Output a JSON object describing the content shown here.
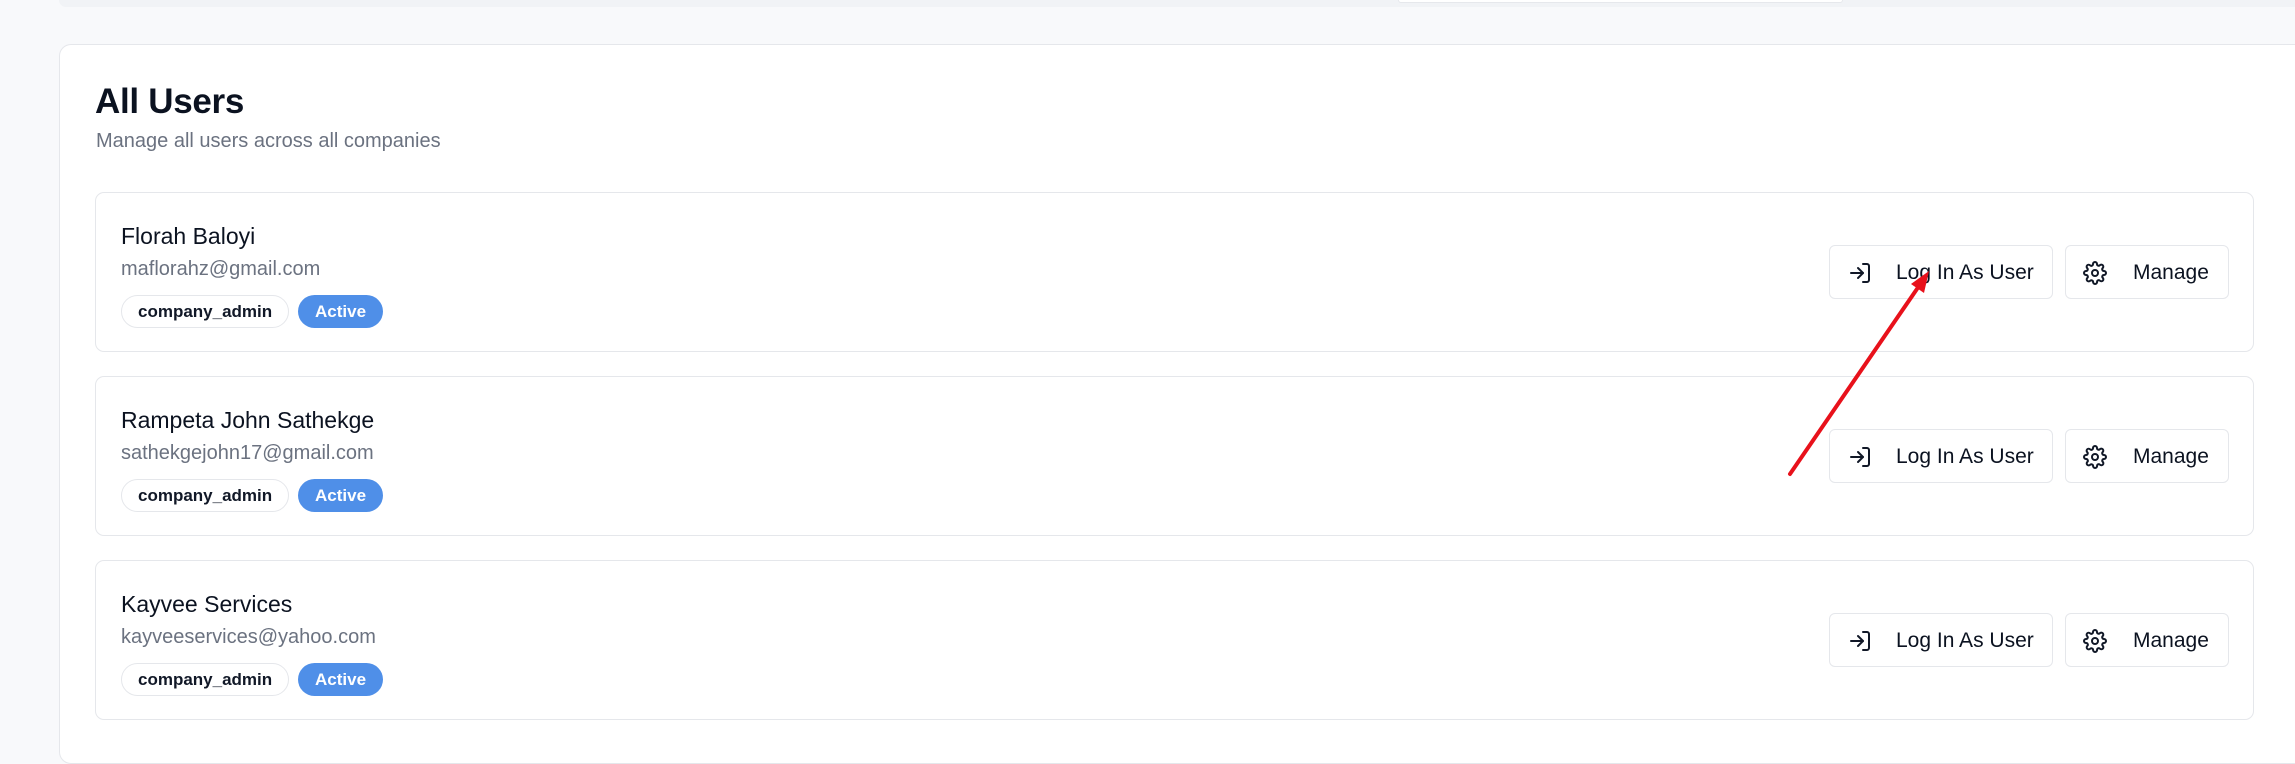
{
  "page": {
    "title": "All Users",
    "subtitle": "Manage all users across all companies"
  },
  "users": [
    {
      "name": "Florah Baloyi",
      "email": "maflorahz@gmail.com",
      "role": "company_admin",
      "status": "Active"
    },
    {
      "name": "Rampeta John Sathekge",
      "email": "sathekgejohn17@gmail.com",
      "role": "company_admin",
      "status": "Active"
    },
    {
      "name": "Kayvee Services",
      "email": "kayveeservices@yahoo.com",
      "role": "company_admin",
      "status": "Active"
    }
  ],
  "actions": {
    "login_label": "Log In As User",
    "manage_label": "Manage"
  },
  "icons": {
    "login": "log-in-icon",
    "manage": "gear-icon"
  },
  "colors": {
    "status_badge": "#4f8fe8",
    "annotation_arrow": "#e8111b"
  }
}
